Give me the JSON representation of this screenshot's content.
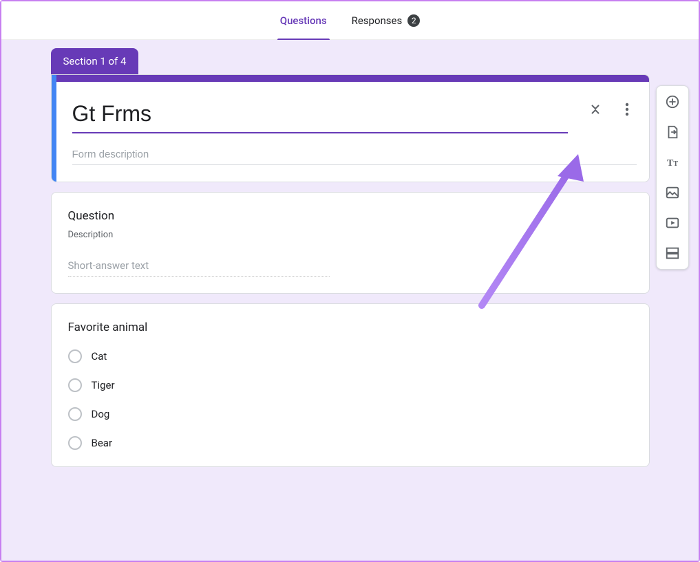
{
  "tabs": {
    "questions": "Questions",
    "responses": "Responses",
    "responses_count": "2"
  },
  "section": {
    "label": "Section 1 of 4",
    "title": "Gt Frms",
    "description_placeholder": "Form description"
  },
  "question1": {
    "title": "Question",
    "description": "Description",
    "placeholder": "Short-answer text"
  },
  "question2": {
    "title": "Favorite animal",
    "options": [
      "Cat",
      "Tiger",
      "Dog",
      "Bear"
    ]
  },
  "sidebar": {
    "add_question": "plus-circle-icon",
    "import": "file-import-icon",
    "title_desc": "text-icon",
    "image": "image-icon",
    "video": "video-icon",
    "section": "section-icon"
  }
}
